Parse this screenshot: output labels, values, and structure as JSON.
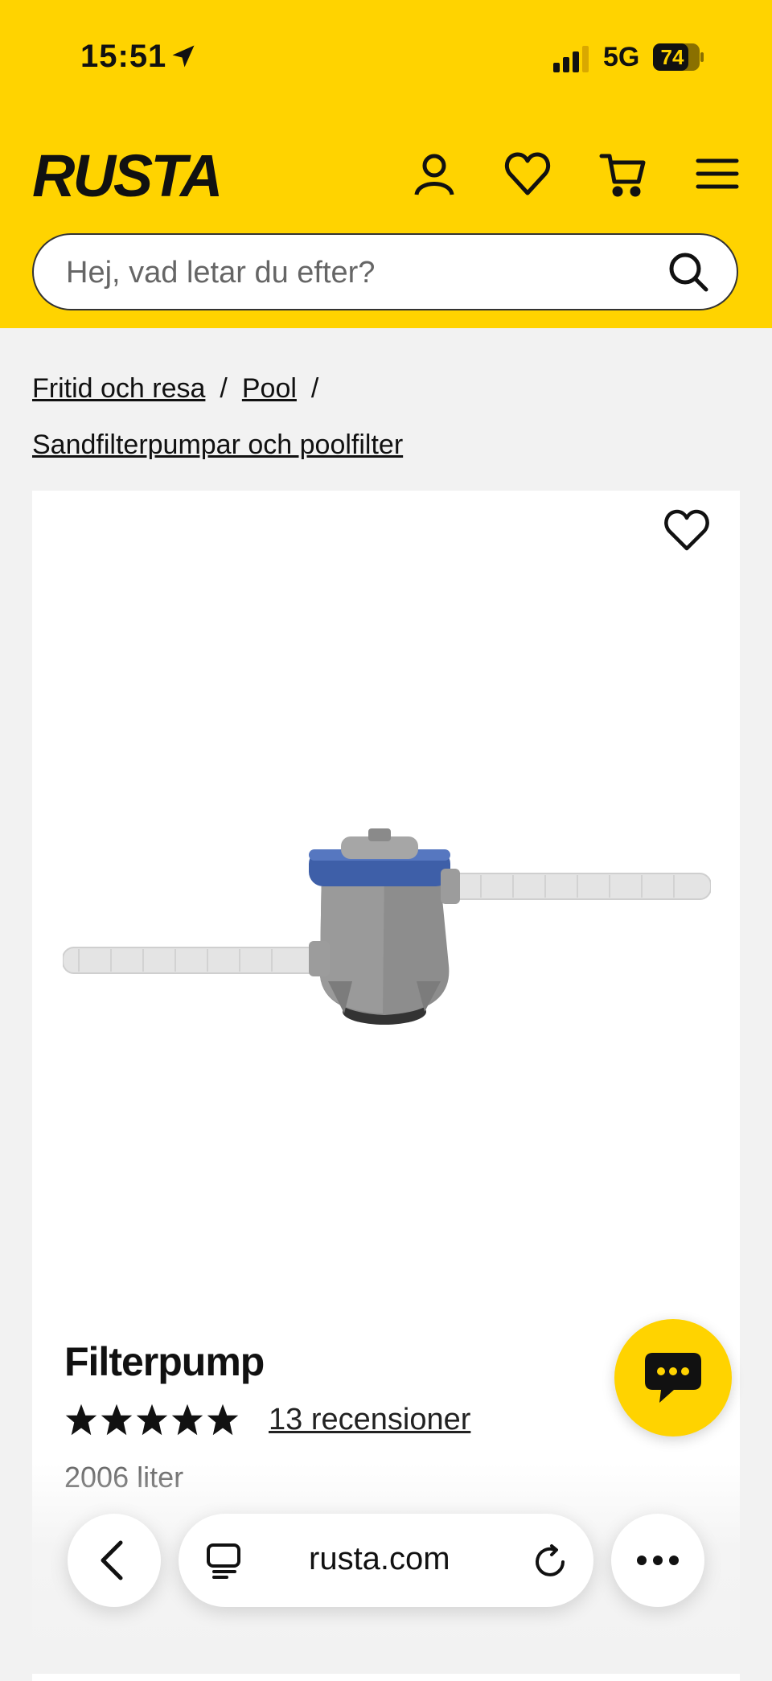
{
  "status_bar": {
    "time": "15:51",
    "network": "5G",
    "battery": "74"
  },
  "header": {
    "logo_text": "RUSTA",
    "account_icon": "user-icon",
    "wishlist_icon": "heart-icon",
    "cart_icon": "cart-icon",
    "menu_icon": "hamburger-icon"
  },
  "search": {
    "placeholder": "Hej, vad letar du efter?",
    "value": ""
  },
  "breadcrumb": {
    "items": [
      "Fritid och resa",
      "Pool",
      "Sandfilterpumpar och poolfilter"
    ],
    "separator": "/"
  },
  "product": {
    "title": "Filterpump",
    "rating": 5,
    "reviews": "13 recensioner",
    "variant": "2006 liter",
    "image_alt": "filter-pump-image"
  },
  "browser_bar": {
    "url": "rusta.com"
  },
  "colors": {
    "brand_yellow": "#ffd300",
    "background": "#f2f2f2"
  }
}
